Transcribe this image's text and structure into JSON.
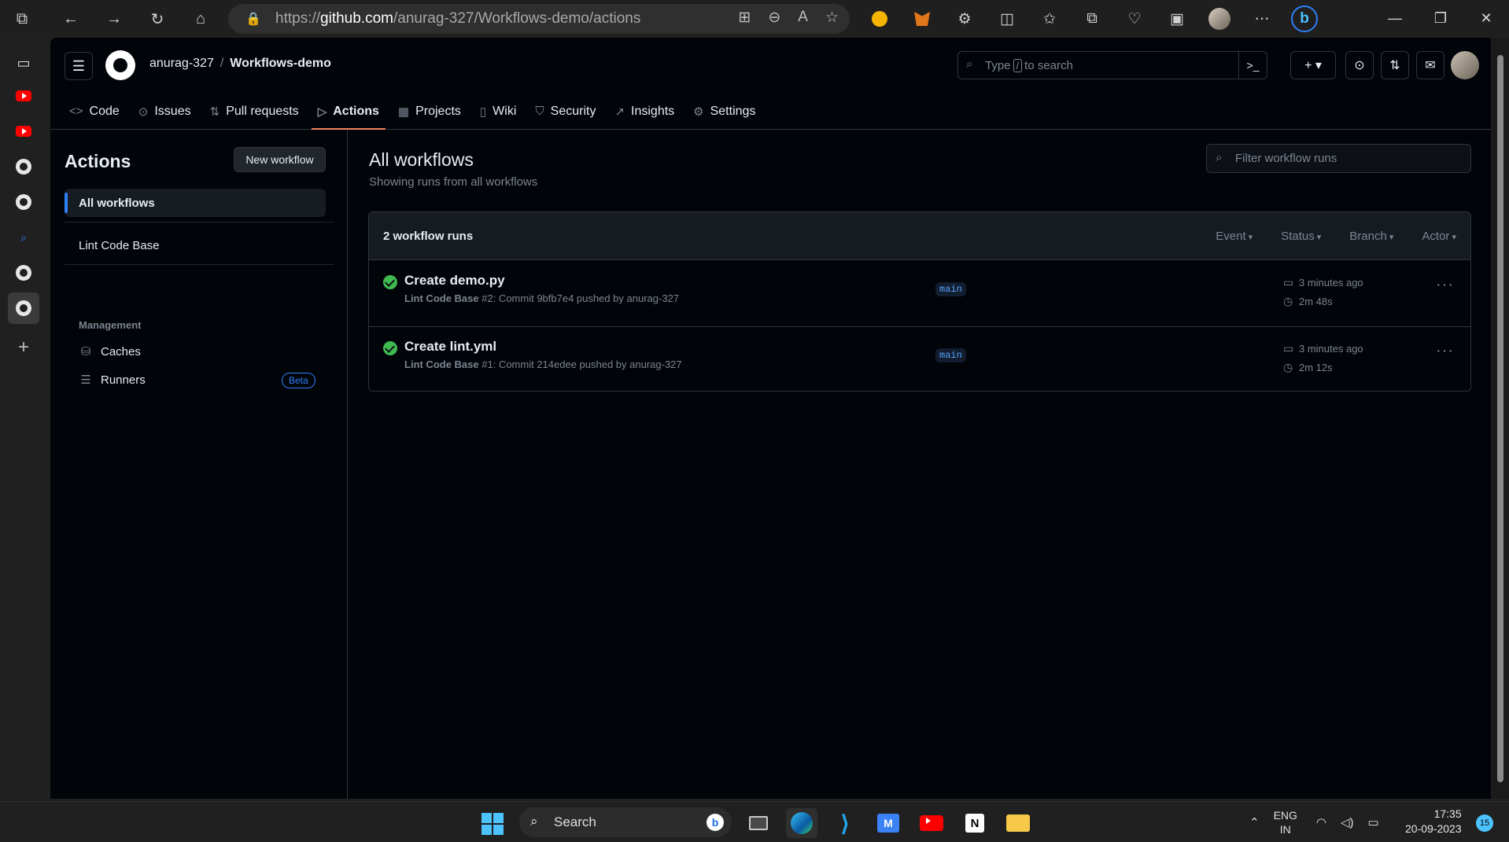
{
  "browser": {
    "url_prefix": "https://",
    "url_host": "github.com",
    "url_path": "/anurag-327/Workflows-demo/actions",
    "icons": [
      "tab-actions-icon",
      "back-icon",
      "forward-icon",
      "refresh-icon",
      "home-icon",
      "lock-icon",
      "apps-icon",
      "zoom-icon",
      "read-aloud-icon",
      "favorite-icon",
      "extensions-icon",
      "split-screen-icon",
      "favorites-bar-icon",
      "collections-icon",
      "browser-essentials-icon",
      "screenshot-icon",
      "profile-avatar",
      "more-icon",
      "bing-copilot-icon"
    ]
  },
  "github": {
    "owner": "anurag-327",
    "separator": "/",
    "repo": "Workflows-demo",
    "search": {
      "prefix": "Type",
      "key": "/",
      "suffix": "to search"
    },
    "tabs": [
      {
        "label": "Code",
        "icon": "code-icon"
      },
      {
        "label": "Issues",
        "icon": "issue-icon"
      },
      {
        "label": "Pull requests",
        "icon": "pull-request-icon"
      },
      {
        "label": "Actions",
        "icon": "play-icon",
        "active": true
      },
      {
        "label": "Projects",
        "icon": "table-icon"
      },
      {
        "label": "Wiki",
        "icon": "book-icon"
      },
      {
        "label": "Security",
        "icon": "shield-icon"
      },
      {
        "label": "Insights",
        "icon": "graph-icon"
      },
      {
        "label": "Settings",
        "icon": "gear-icon"
      }
    ]
  },
  "sidebar": {
    "title": "Actions",
    "new_workflow": "New workflow",
    "all_workflows": "All workflows",
    "workflows": [
      "Lint Code Base"
    ],
    "management_heading": "Management",
    "caches": "Caches",
    "runners": "Runners",
    "runners_badge": "Beta"
  },
  "main": {
    "title": "All workflows",
    "subtitle": "Showing runs from all workflows",
    "filter_placeholder": "Filter workflow runs",
    "runs_count": "2 workflow runs",
    "filters": [
      "Event",
      "Status",
      "Branch",
      "Actor"
    ],
    "runs": [
      {
        "title": "Create demo.py",
        "workflow": "Lint Code Base",
        "meta": "#2: Commit 9bfb7e4 pushed by anurag-327",
        "branch": "main",
        "when": "3 minutes ago",
        "duration": "2m 48s",
        "status": "success"
      },
      {
        "title": "Create lint.yml",
        "workflow": "Lint Code Base",
        "meta": "#1: Commit 214edee pushed by anurag-327",
        "branch": "main",
        "when": "3 minutes ago",
        "duration": "2m 12s",
        "status": "success"
      }
    ]
  },
  "taskbar": {
    "search": "Search",
    "lang_1": "ENG",
    "lang_2": "IN",
    "time": "17:35",
    "date": "20-09-2023",
    "notifications": "15"
  },
  "colors": {
    "accent_tab": "#f78166",
    "success": "#3fb950",
    "link": "#2f81f7"
  }
}
